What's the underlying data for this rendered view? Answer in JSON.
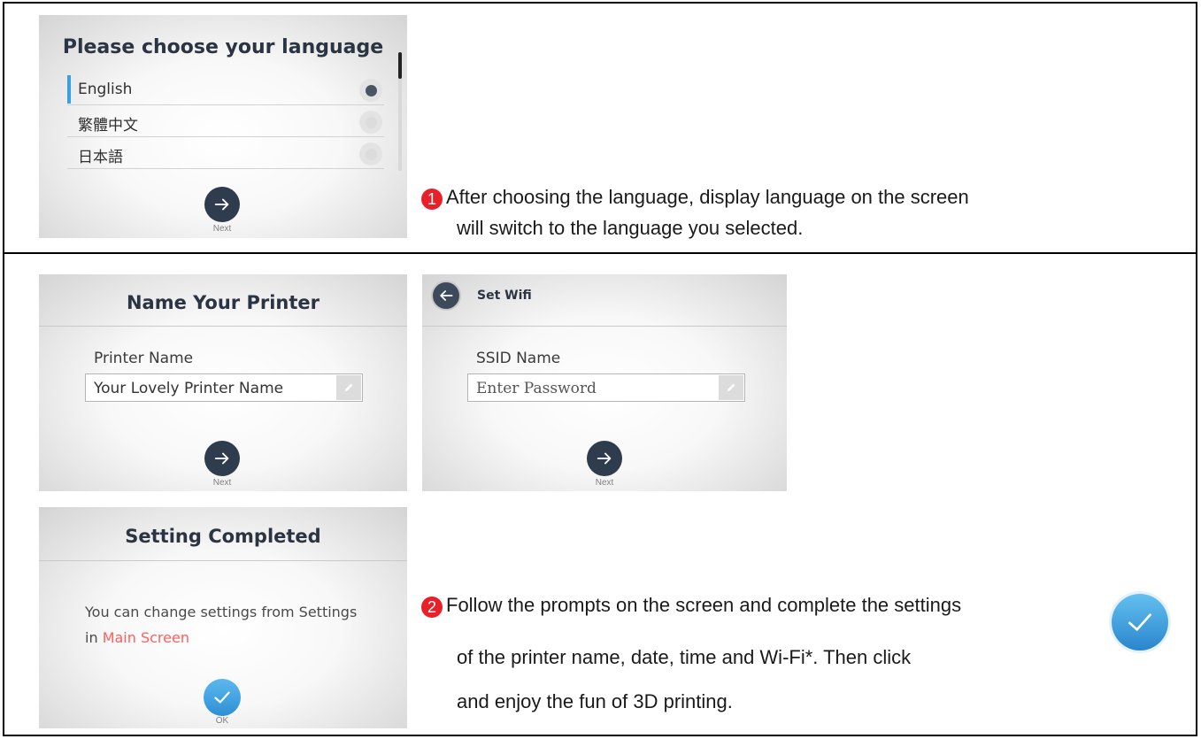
{
  "language_screen": {
    "title": "Please choose your language",
    "languages": [
      {
        "label": "English",
        "selected": true
      },
      {
        "label": "繁體中文",
        "selected": false
      },
      {
        "label": "日本語",
        "selected": false
      }
    ],
    "next_label": "Next"
  },
  "step1": {
    "number": "1",
    "line1": "After choosing the language, display language on the screen",
    "line2": "will switch to the language you selected."
  },
  "printer_screen": {
    "title": "Name Your Printer",
    "field_label": "Printer Name",
    "field_value": "Your Lovely Printer Name",
    "next_label": "Next"
  },
  "wifi_screen": {
    "title": "Set Wifi",
    "field_label": "SSID Name",
    "field_placeholder": "Enter Password",
    "next_label": "Next"
  },
  "complete_screen": {
    "title": "Setting Completed",
    "message_prefix": "You can change settings from Settings",
    "message_in": "in",
    "message_link": "Main Screen",
    "ok_label": "OK"
  },
  "step2": {
    "number": "2",
    "line1": "Follow the prompts on the screen and complete the settings",
    "line2": "of the printer name, date, time and Wi-Fi*. Then click",
    "line3": "and enjoy the fun of 3D printing."
  },
  "colors": {
    "accent_blue": "#3ba0e0",
    "button_dark": "#2f3c4d",
    "step_red": "#e8202a",
    "link_red": "#ff5f5f"
  }
}
